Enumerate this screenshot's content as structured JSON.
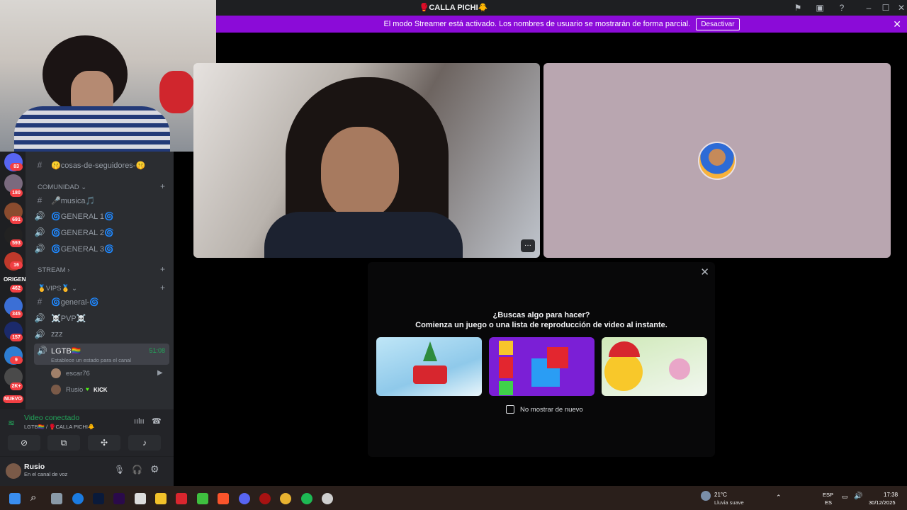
{
  "window": {
    "title": "🥊CALLA PICHI🐥"
  },
  "banner": {
    "text": "El modo Streamer está activado. Los nombres de usuario se mostrarán de forma parcial.",
    "button": "Desactivar",
    "close": "✕"
  },
  "rail_badges": [
    "83",
    "180",
    "691",
    "593",
    "16",
    "462",
    "345",
    "157",
    "9",
    "2K+",
    "NUEVO"
  ],
  "rail_label_origen": "ORIGEN",
  "channels": {
    "top_channel": "🤫cosas-de-seguidores-🤫",
    "cat_comunidad": "COMUNIDAD",
    "musica": "🎤musica🎵",
    "general1": "🌀GENERAL 1🌀",
    "general2": "🌀GENERAL 2🌀",
    "general3": "🌀GENERAL 3🌀",
    "cat_stream": "STREAM",
    "cat_vips": "🥇VIPS🥇",
    "general_vip": "🌀general-🌀",
    "pvp": "☠️PVP☠️",
    "zzz": "zzz",
    "lgtb": "LGTB🏳️‍🌈",
    "lgtb_time": "51:08",
    "lgtb_status": "Establece un estado para el canal",
    "member1": "escar76",
    "member2": "Rusio",
    "member2_tag": "KICK"
  },
  "voice": {
    "status": "Video conectado",
    "location": "LGTB🏳️‍🌈 / 🥊CALLA PICHI🐥"
  },
  "user": {
    "name": "Rusio",
    "status": "En el canal de voz"
  },
  "modal": {
    "question": "¿Buscas algo para hacer?",
    "subtitle": "Comienza un juego o una lista de reproducción de video al instante.",
    "checkbox_label": "No mostrar de nuevo",
    "close": "✕"
  },
  "tile1": {
    "more": "···"
  },
  "taskbar": {
    "weather_temp": "21°C",
    "weather_desc": "Lluvia suave",
    "lang1": "ESP",
    "lang2": "ES",
    "time": "17:38",
    "date": "30/12/2025"
  }
}
